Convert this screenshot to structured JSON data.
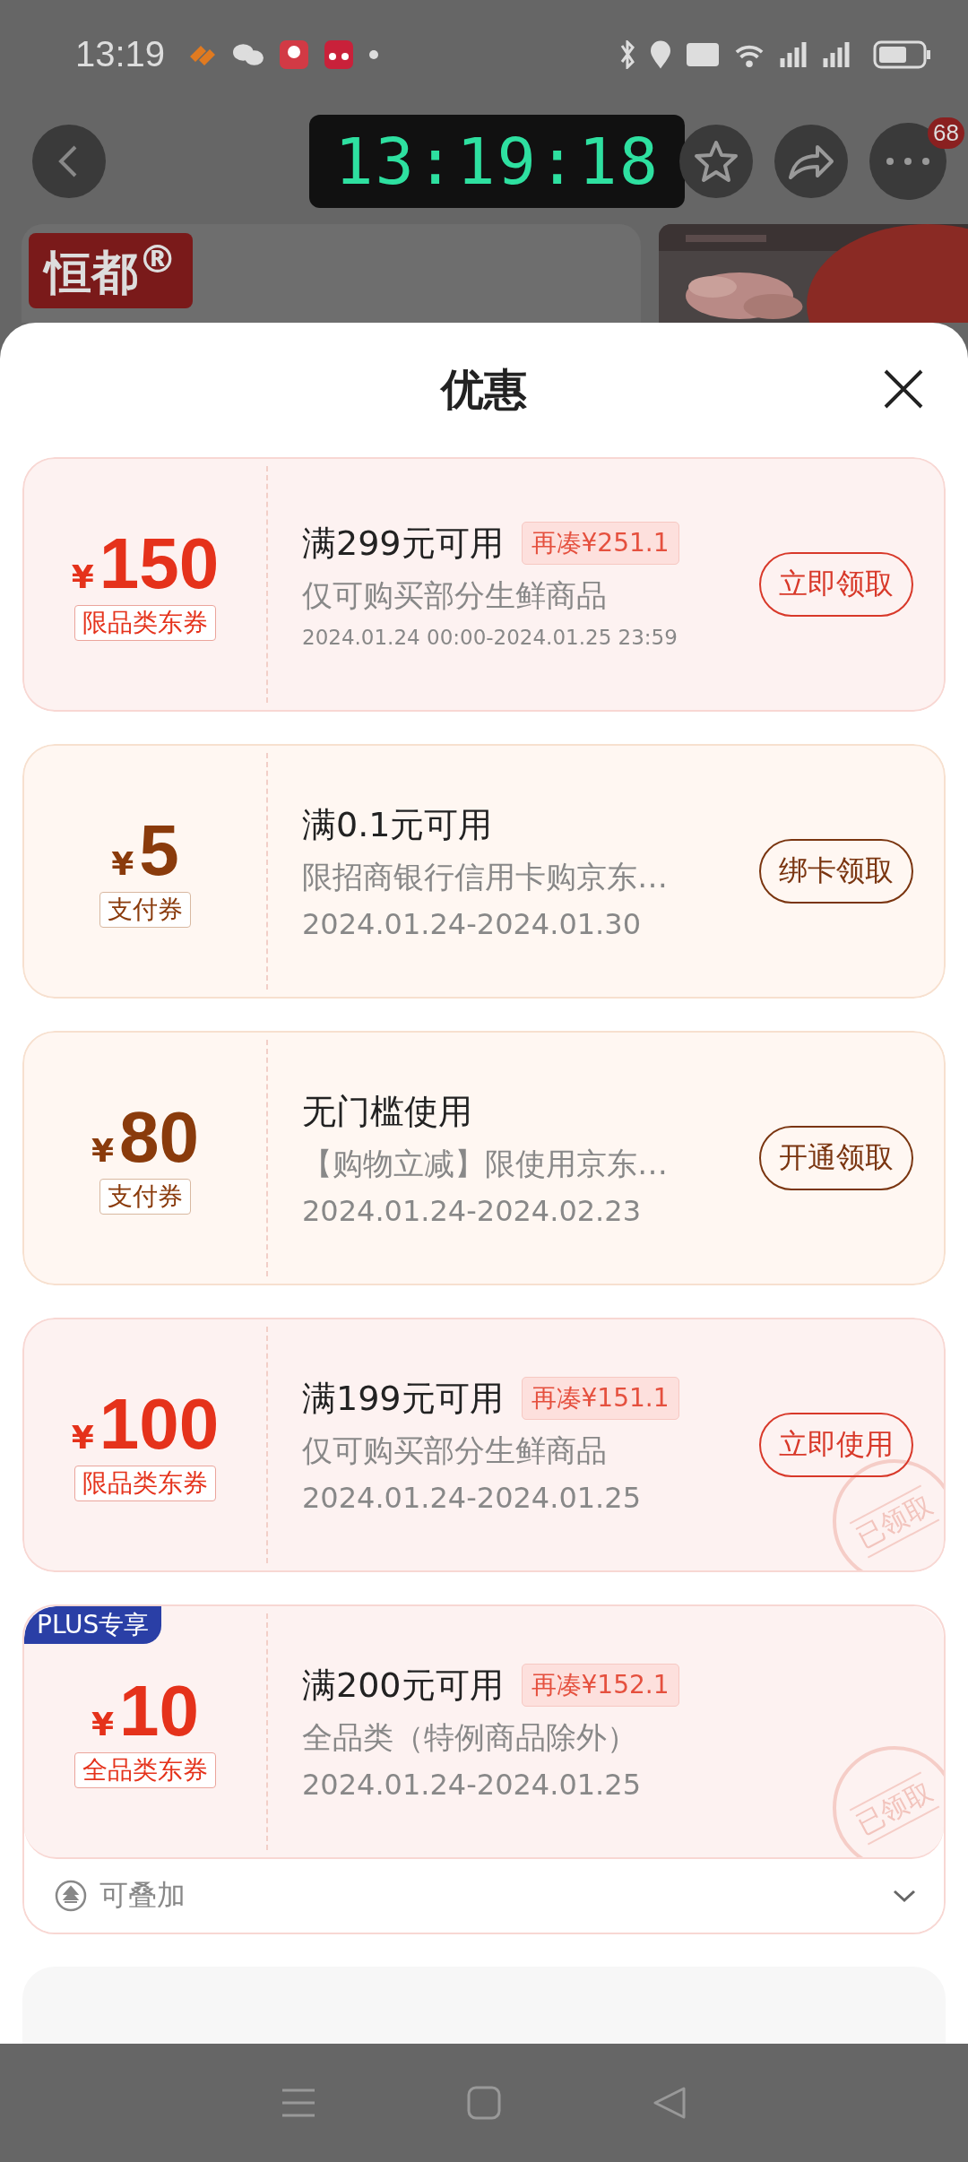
{
  "status_bar": {
    "time": "13:19"
  },
  "clock_widget": {
    "time": "13:19:18"
  },
  "header": {
    "badge": "68",
    "brand": "恒都$^{®}$"
  },
  "sheet": {
    "title": "优惠"
  },
  "coupons": [
    {
      "kind": "category",
      "currency": "¥",
      "amount": "150",
      "type_tag": "限品类东券",
      "title": "满299元可用",
      "extra_tag": "再凑¥251.1",
      "description": "仅可购买部分生鲜商品",
      "validity": "2024.01.24 00:00-2024.01.25 23:59",
      "button": "立即领取",
      "claimed": false
    },
    {
      "kind": "payment",
      "currency": "¥",
      "amount": "5",
      "type_tag": "支付券",
      "title": "满0.1元可用",
      "description": "限招商银行信用卡购京东…",
      "validity": "2024.01.24-2024.01.30",
      "button": "绑卡领取",
      "claimed": false
    },
    {
      "kind": "payment",
      "currency": "¥",
      "amount": "80",
      "type_tag": "支付券",
      "title": "无门槛使用",
      "description": "【购物立减】限使用京东…",
      "validity": "2024.01.24-2024.02.23",
      "button": "开通领取",
      "claimed": false
    },
    {
      "kind": "category",
      "currency": "¥",
      "amount": "100",
      "type_tag": "限品类东券",
      "title": "满199元可用",
      "extra_tag": "再凑¥151.1",
      "description": "仅可购买部分生鲜商品",
      "validity": "2024.01.24-2024.01.25",
      "button": "立即使用",
      "claimed": true,
      "stamp": "已领取"
    },
    {
      "kind": "category",
      "currency": "¥",
      "amount": "10",
      "type_tag": "全品类东券",
      "title": "满200元可用",
      "extra_tag": "再凑¥152.1",
      "description": "全品类（特例商品除外）",
      "validity": "2024.01.24-2024.01.25",
      "claimed": true,
      "stamp": "已领取",
      "plus_badge": "PLUS专享",
      "footer": "可叠加"
    }
  ]
}
